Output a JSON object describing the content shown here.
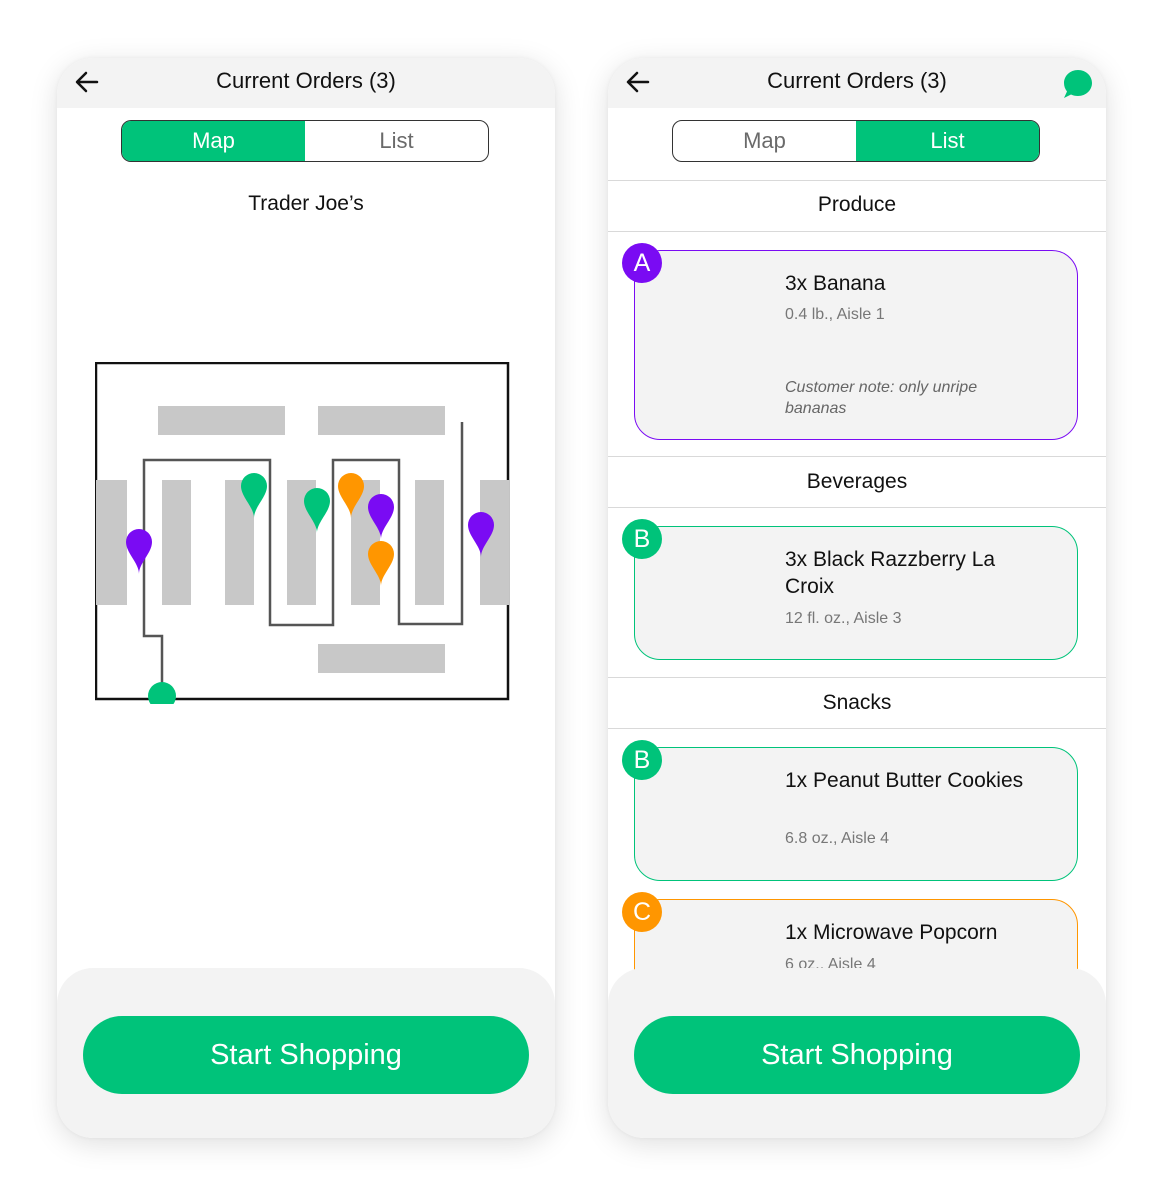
{
  "left_screen": {
    "header_title": "Current Orders (3)",
    "tabs": {
      "map": "Map",
      "list": "List",
      "active": "map"
    },
    "store_name": "Trader Joe’s",
    "map": {
      "icons": [
        "back-arrow-icon"
      ],
      "pin_colors": {
        "A": "#7a0bf3",
        "B": "#00c37a",
        "C": "#ff9600"
      }
    },
    "start_button": "Start Shopping"
  },
  "right_screen": {
    "header_title": "Current Orders (3)",
    "tabs": {
      "map": "Map",
      "list": "List",
      "active": "list"
    },
    "icons": [
      "back-arrow-icon",
      "chat-bubble-icon"
    ],
    "sections": [
      {
        "title": "Produce",
        "items": [
          {
            "badge": "A",
            "color": "#7a0bf3",
            "name": "3x Banana",
            "meta": "0.4 lb., Aisle 1",
            "note": "Customer note: only unripe bananas"
          }
        ]
      },
      {
        "title": "Beverages",
        "items": [
          {
            "badge": "B",
            "color": "#00c37a",
            "name": "3x Black Razzberry La Croix",
            "meta": "12 fl. oz., Aisle 3"
          }
        ]
      },
      {
        "title": "Snacks",
        "items": [
          {
            "badge": "B",
            "color": "#00c37a",
            "name": "1x Peanut Butter Cookies",
            "meta": "6.8 oz., Aisle 4"
          },
          {
            "badge": "C",
            "color": "#ff9600",
            "name": "1x Microwave Popcorn",
            "meta": "6 oz., Aisle 4"
          }
        ]
      }
    ],
    "start_button": "Start Shopping"
  }
}
